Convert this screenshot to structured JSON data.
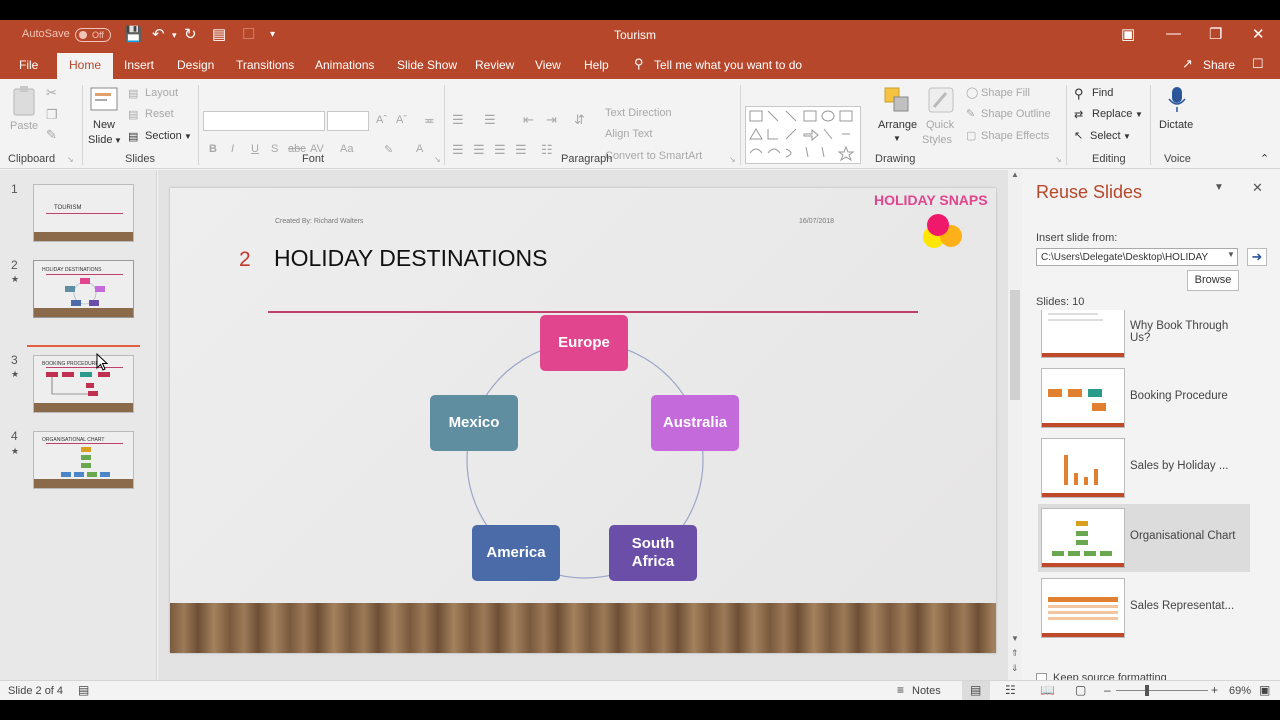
{
  "titlebar": {
    "autosave_label": "AutoSave",
    "autosave_state": "Off",
    "document_title": "Tourism"
  },
  "tabs": [
    "File",
    "Home",
    "Insert",
    "Design",
    "Transitions",
    "Animations",
    "Slide Show",
    "Review",
    "View",
    "Help"
  ],
  "active_tab": "Home",
  "tell_me": "Tell me what you want to do",
  "share_label": "Share",
  "ribbon": {
    "clipboard": {
      "paste": "Paste",
      "label": "Clipboard"
    },
    "slides": {
      "new_slide_1": "New",
      "new_slide_2": "Slide",
      "layout": "Layout",
      "reset": "Reset",
      "section": "Section",
      "label": "Slides"
    },
    "font": {
      "label": "Font",
      "bold": "B",
      "italic": "I",
      "underline": "U",
      "strike": "S",
      "shadow": "abc",
      "spacing": "AV",
      "case": "Aa",
      "color": "A"
    },
    "paragraph": {
      "label": "Paragraph",
      "text_direction": "Text Direction",
      "align_text": "Align Text",
      "convert_smartart": "Convert to SmartArt"
    },
    "drawing": {
      "label": "Drawing",
      "arrange": "Arrange",
      "quick_styles_1": "Quick",
      "quick_styles_2": "Styles",
      "shape_fill": "Shape Fill",
      "shape_outline": "Shape Outline",
      "shape_effects": "Shape Effects"
    },
    "editing": {
      "label": "Editing",
      "find": "Find",
      "replace": "Replace",
      "select": "Select"
    },
    "voice": {
      "label": "Voice",
      "dictate": "Dictate"
    }
  },
  "slide_thumbs": [
    {
      "number": "1",
      "starred": false,
      "title": "TOURISM"
    },
    {
      "number": "2",
      "starred": true,
      "title": "HOLIDAY DESTINATIONS"
    },
    {
      "number": "3",
      "starred": true,
      "title": "BOOKING PROCEDURE"
    },
    {
      "number": "4",
      "starred": true,
      "title": "ORGANISATIONAL CHART"
    }
  ],
  "slide": {
    "created_by": "Created By: Richard Walters",
    "date": "16/07/2018",
    "logo": "HOLIDAY SNAPS",
    "number": "2",
    "title": "HOLIDAY DESTINATIONS",
    "nodes": [
      {
        "label": "Europe",
        "color": "#e0458e"
      },
      {
        "label": "Australia",
        "color": "#c46adb"
      },
      {
        "label": "South Africa",
        "color": "#6b4ea8"
      },
      {
        "label": "America",
        "color": "#4a6aa8"
      },
      {
        "label": "Mexico",
        "color": "#5f8ea0"
      }
    ]
  },
  "reuse_pane": {
    "title": "Reuse Slides",
    "insert_from_label": "Insert slide from:",
    "path": "C:\\Users\\Delegate\\Desktop\\HOLIDAY",
    "browse": "Browse",
    "count": "Slides: 10",
    "items": [
      "Why Book Through Us?",
      "Booking Procedure",
      "Sales by Holiday ...",
      "Organisational Chart",
      "Sales Representat..."
    ],
    "selected_item": "Organisational Chart",
    "keep_formatting": "Keep source formatting"
  },
  "statusbar": {
    "slide_info": "Slide 2 of 4",
    "notes": "Notes",
    "zoom": "69%"
  },
  "colors": {
    "accent": "#b7472a",
    "title_number": "#c0392b",
    "logo": "#e0458e"
  }
}
